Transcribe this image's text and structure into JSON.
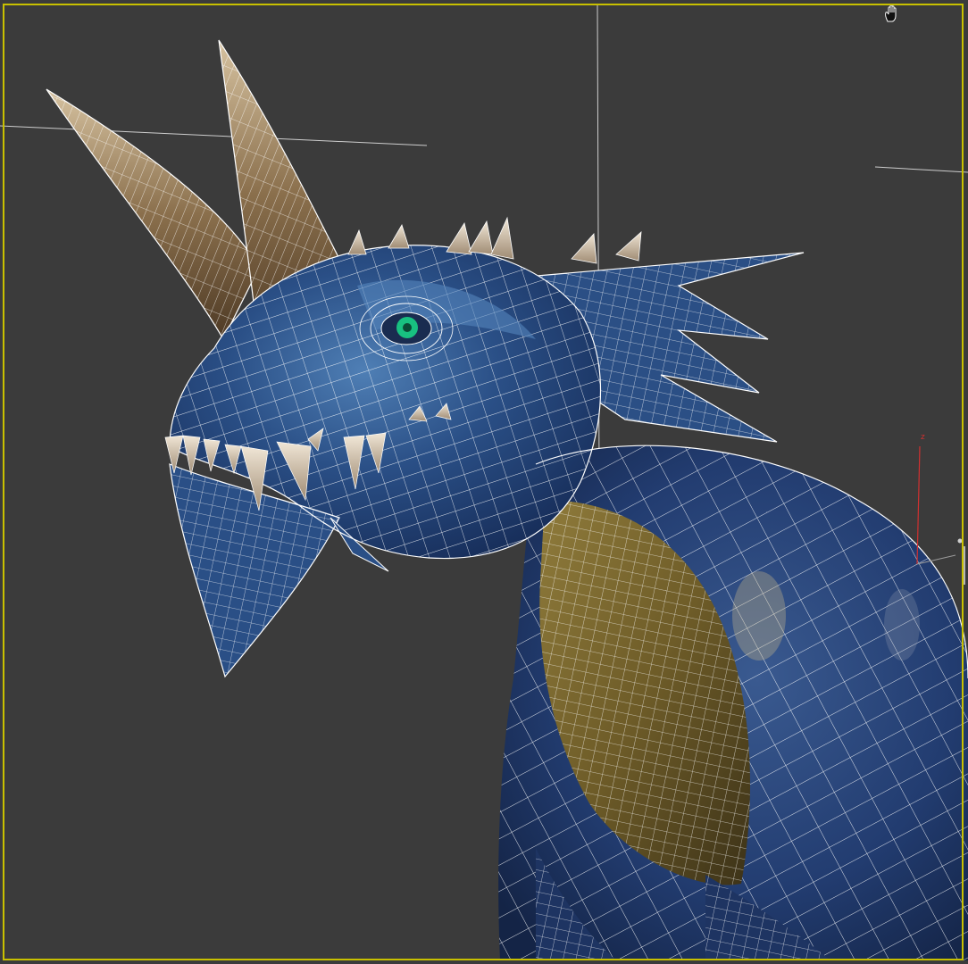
{
  "viewport": {
    "background": "#3b3b3b",
    "border_color": "#c8c000",
    "active": true
  },
  "gizmo": {
    "axis_label": "z",
    "axis_color": "#d03030"
  },
  "cursor": {
    "icon": "pan-hand-icon"
  },
  "model": {
    "palette": {
      "body_blue": "#2a4a7a",
      "body_dark": "#1b2f55",
      "belly": "#7a6a30",
      "horn": "#8a7050",
      "wire": "#ffffff",
      "eye": "#18c080"
    }
  }
}
